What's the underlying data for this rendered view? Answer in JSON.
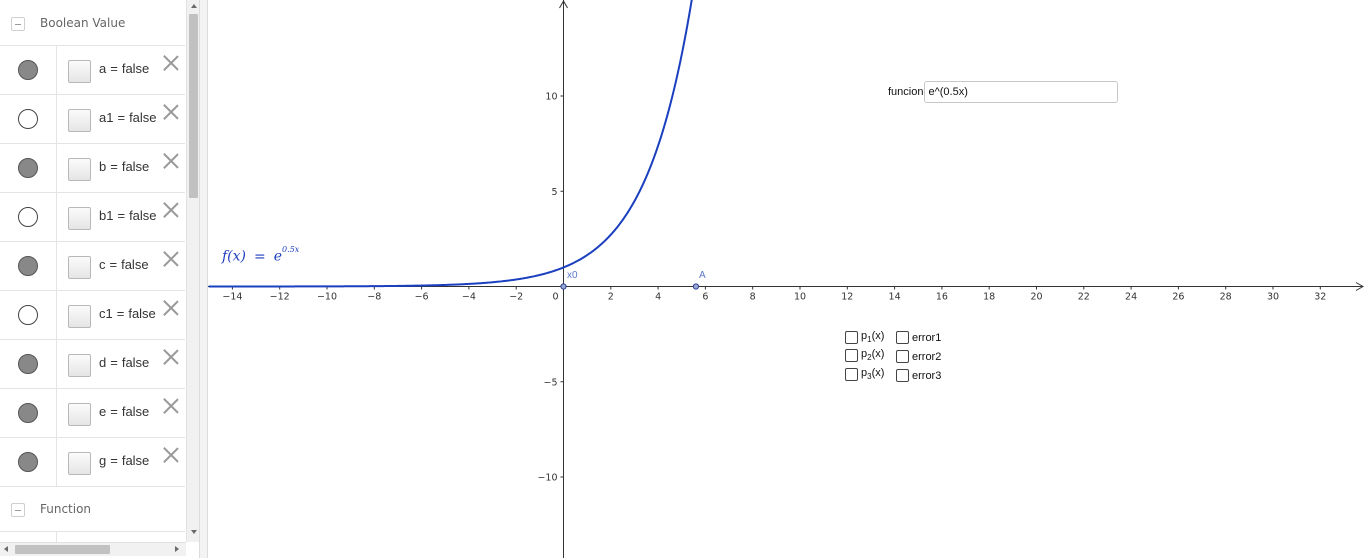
{
  "algebra": {
    "groups": {
      "boolean": {
        "label": "Boolean Value"
      },
      "function": {
        "label": "Function"
      }
    },
    "items": [
      {
        "name": "a",
        "value": "false",
        "visible": true
      },
      {
        "name": "a1",
        "value": "false",
        "visible": false
      },
      {
        "name": "b",
        "value": "false",
        "visible": true
      },
      {
        "name": "b1",
        "value": "false",
        "visible": false
      },
      {
        "name": "c",
        "value": "false",
        "visible": true
      },
      {
        "name": "c1",
        "value": "false",
        "visible": false
      },
      {
        "name": "d",
        "value": "false",
        "visible": true
      },
      {
        "name": "e",
        "value": "false",
        "visible": true
      },
      {
        "name": "g",
        "value": "false",
        "visible": true
      }
    ],
    "equals_sign": "="
  },
  "graphics": {
    "function_label": {
      "lhs": "f(x)",
      "eq": "=",
      "base": "e",
      "exponent": "0.5x"
    },
    "points": {
      "x0": "x0",
      "A": "A"
    },
    "input_box": {
      "label": "funcion",
      "value": "e^(0.5x)"
    },
    "checkboxes": [
      {
        "id": "p1",
        "base": "p",
        "sub": "1",
        "suffix": "(x)"
      },
      {
        "id": "p2",
        "base": "p",
        "sub": "2",
        "suffix": "(x)"
      },
      {
        "id": "p3",
        "base": "p",
        "sub": "3",
        "suffix": "(x)"
      },
      {
        "id": "error1",
        "text": "error1"
      },
      {
        "id": "error2",
        "text": "error2"
      },
      {
        "id": "error3",
        "text": "error3"
      }
    ],
    "colors": {
      "curve": "#1a3fbf",
      "axis": "#333333",
      "point": "#5b79c9"
    }
  },
  "chart_data": {
    "type": "line",
    "title": "",
    "xlabel": "",
    "ylabel": "",
    "xlim": [
      -15,
      34
    ],
    "ylim": [
      -14,
      15
    ],
    "x_ticks": [
      -14,
      -12,
      -10,
      -8,
      -6,
      -4,
      -2,
      0,
      2,
      4,
      6,
      8,
      10,
      12,
      14,
      16,
      18,
      20,
      22,
      24,
      26,
      28,
      30,
      32
    ],
    "y_ticks": [
      -10,
      -5,
      5,
      10
    ],
    "series": [
      {
        "expression": "e^(0.5x)",
        "x": [
          -15,
          -10,
          -6,
          -4,
          -2,
          0,
          2,
          3,
          4,
          5,
          5.4
        ],
        "y": [
          0.0,
          0.01,
          0.05,
          0.14,
          0.37,
          1.0,
          2.72,
          4.48,
          7.39,
          12.18,
          14.88
        ]
      }
    ],
    "points": [
      {
        "label": "x0",
        "x": 0,
        "y": 0
      },
      {
        "label": "A",
        "x": 5.6,
        "y": 0
      }
    ],
    "grid": false
  }
}
